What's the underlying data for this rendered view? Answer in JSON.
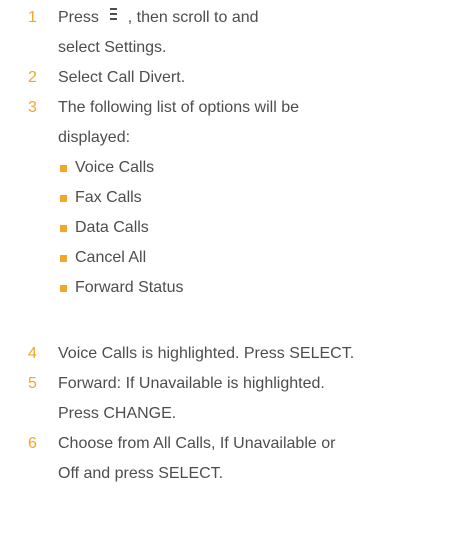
{
  "accent_color": "#f5a623",
  "text_color": "#4d4d4d",
  "steps": [
    {
      "number": "1",
      "line1_before_icon": "Press ",
      "icon": "menu-icon",
      "line1_after_icon": " , then scroll to and",
      "line2": "select Settings."
    },
    {
      "number": "2",
      "line1": "Select Call Divert."
    },
    {
      "number": "3",
      "line1": "The following list of options will be",
      "line2": "displayed:"
    },
    {
      "number": "4",
      "line1": "Voice Calls is highlighted. Press SELECT."
    },
    {
      "number": "5",
      "line1": "Forward: If Unavailable is highlighted.",
      "line2": "Press CHANGE."
    },
    {
      "number": "6",
      "line1": "Choose from All Calls, If Unavailable or",
      "line2": "Off and press SELECT."
    }
  ],
  "options": [
    "Voice Calls",
    "Fax Calls",
    "Data Calls",
    "Cancel All",
    "Forward Status"
  ]
}
